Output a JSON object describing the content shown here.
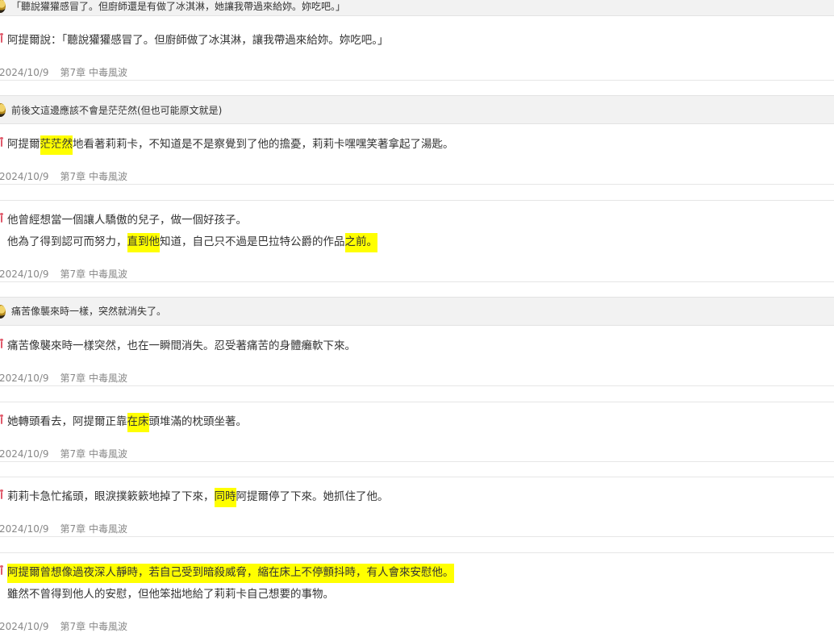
{
  "notes": [
    {
      "quote": "「聽說獾獾感冒了。但廚師還是有做了冰淇淋，她讓我帶過來給妳。妳吃吧。」",
      "lines": [
        [
          {
            "t": "阿提爾說：「聽說獾獾感冒了。但廚師做了冰淇淋，讓我帶過來給妳。妳吃吧。」"
          }
        ]
      ],
      "date": "2024/10/9",
      "chapter": "第7章 中毒風波"
    },
    {
      "quote": "前後文這邊應該不會是茫茫然(但也可能原文就是)",
      "lines": [
        [
          {
            "t": "阿提爾"
          },
          {
            "t": "茫茫然",
            "h": true
          },
          {
            "t": "地看著莉莉卡，不知道是不是察覺到了他的擔憂，莉莉卡嘿嘿笑著拿起了湯匙。"
          }
        ]
      ],
      "date": "2024/10/9",
      "chapter": "第7章 中毒風波"
    },
    {
      "quote": "",
      "lines": [
        [
          {
            "t": "他曾經想當一個讓人驕傲的兒子，做一個好孩子。"
          }
        ],
        [
          {
            "t": "他為了得到認可而努力，"
          },
          {
            "t": "直到他",
            "h": true
          },
          {
            "t": "知道，自己只不過是巴拉特公爵的作品"
          },
          {
            "t": "之前。",
            "h": true
          }
        ]
      ],
      "date": "2024/10/9",
      "chapter": "第7章 中毒風波"
    },
    {
      "quote": "痛苦像襲來時一樣，突然就消失了。",
      "lines": [
        [
          {
            "t": "痛苦像襲來時一樣突然，也在一瞬間消失。忍受著痛苦的身體癱軟下來。"
          }
        ]
      ],
      "date": "2024/10/9",
      "chapter": "第7章 中毒風波"
    },
    {
      "quote": "",
      "lines": [
        [
          {
            "t": "她轉頭看去，阿提爾正靠"
          },
          {
            "t": "在床",
            "h": true
          },
          {
            "t": "頭堆滿的枕頭坐著。"
          }
        ]
      ],
      "date": "2024/10/9",
      "chapter": "第7章 中毒風波"
    },
    {
      "quote": "",
      "lines": [
        [
          {
            "t": "莉莉卡急忙搖頭，眼淚撲簌簌地掉了下來，"
          },
          {
            "t": "同時",
            "h": true
          },
          {
            "t": "阿提爾停了下來。她抓住了他。"
          }
        ]
      ],
      "date": "2024/10/9",
      "chapter": "第7章 中毒風波"
    },
    {
      "quote": "",
      "lines": [
        [
          {
            "t": "阿提爾曾想像過夜深人靜時，若自己受到暗殺威脅，縮在床上不停顫抖時，有人會來安慰他。",
            "h": true
          }
        ],
        [
          {
            "t": "雖然不曾得到他人的安慰，但他笨拙地給了莉莉卡自己想要的事物。"
          }
        ]
      ],
      "date": "2024/10/9",
      "chapter": "第7章 中毒風波"
    }
  ]
}
